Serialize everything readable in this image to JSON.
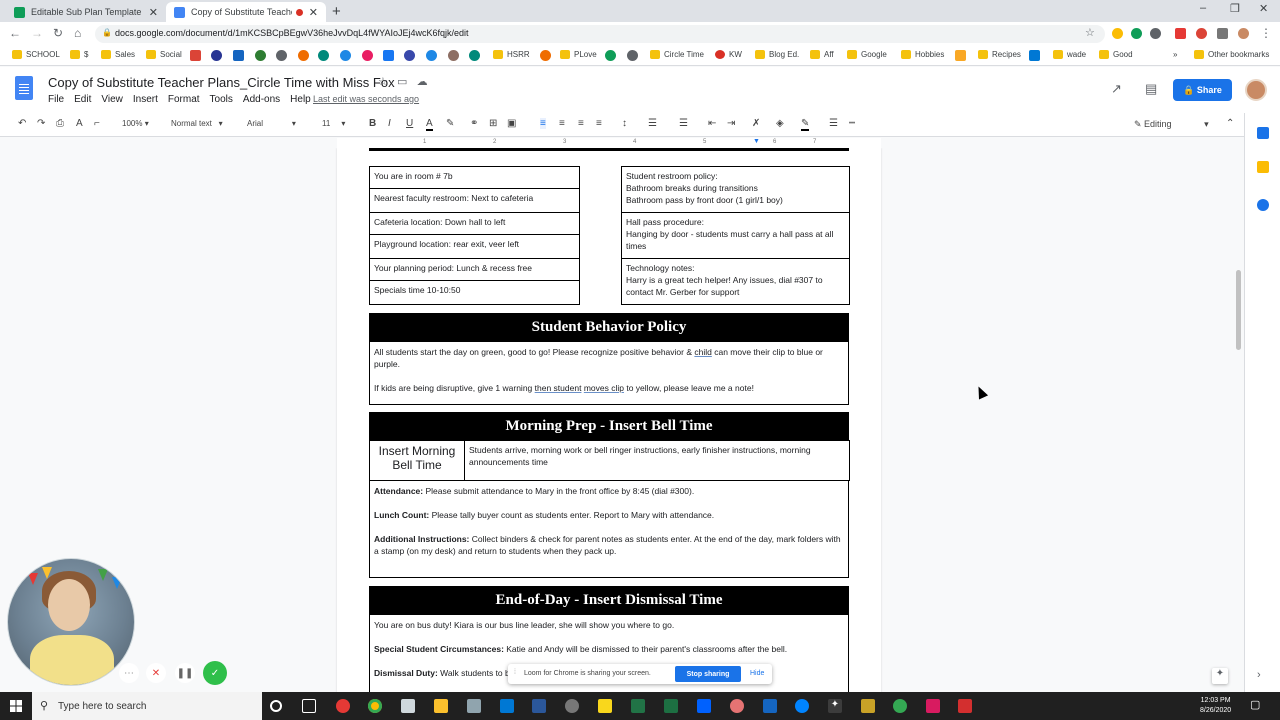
{
  "browser": {
    "tabs": [
      {
        "title": "Editable Sub Plan Template with",
        "favicon_color": "#0f9d58"
      },
      {
        "title": "Copy of Substitute Teacher P",
        "favicon_color": "#4285f4",
        "active": true
      }
    ],
    "new_tab_label": "+",
    "window_controls": {
      "minimize": "–",
      "restore": "❐",
      "close": "✕"
    },
    "url": "docs.google.com/document/d/1mKCSBCpBEgwV36heJvvDqL4fWYAIoJEj4wcK6fqjk/edit",
    "bookmarks": [
      "SCHOOL",
      "$",
      "Sales",
      "Social",
      "HSRR",
      "PLove",
      "Circle Time",
      "KW",
      "Blog Ed.",
      "Aff",
      "Google",
      "Hobbies",
      "Recipes",
      "wade",
      "Good",
      "»",
      "Other bookmarks"
    ]
  },
  "docs": {
    "title": "Copy of Substitute Teacher Plans_Circle Time with Miss Fox",
    "menu": [
      "File",
      "Edit",
      "View",
      "Insert",
      "Format",
      "Tools",
      "Add-ons",
      "Help"
    ],
    "last_edit": "Last edit was seconds ago",
    "share_label": "Share",
    "toolbar": {
      "zoom": "100%",
      "style": "Normal text",
      "font": "Arial",
      "size": "11",
      "mode": "Editing"
    },
    "ruler_marks": [
      "1",
      "2",
      "3",
      "4",
      "5",
      "6",
      "7"
    ]
  },
  "document": {
    "left_info": [
      "You are in room # 7b",
      "Nearest faculty restroom: Next to cafeteria",
      "Cafeteria location: Down hall to left",
      "Playground location: rear exit, veer left",
      "Your planning period: Lunch & recess free",
      "Specials time 10-10:50"
    ],
    "right_info": {
      "restroom_1": "Student restroom policy:",
      "restroom_2": "Bathroom breaks during transitions",
      "restroom_3": "Bathroom pass by front door (1 girl/1 boy)",
      "hallpass_1": "Hall pass procedure:",
      "hallpass_2": "Hanging by door - students must carry a hall pass at all times",
      "tech_1": "Technology notes:",
      "tech_2": "Harry is a great tech helper! Any issues, dial #307 to contact Mr. Gerber for support"
    },
    "behavior": {
      "heading": "Student Behavior Policy",
      "p1_a": "All students start the day on green, good to go! Please recognize positive behavior & ",
      "p1_b": "child",
      "p1_c": " can move their clip to blue or purple.",
      "p2_a": "If kids are being disruptive, give 1 warning ",
      "p2_b": "then student",
      "p2_c": " ",
      "p2_d": "moves clip",
      "p2_e": " to yellow, please leave me a note!"
    },
    "morning": {
      "heading": "Morning Prep - Insert Bell Time",
      "bell_label": "Insert Morning Bell Time",
      "bell_desc": "Students arrive, morning work or bell ringer instructions, early finisher instructions, morning announcements time",
      "attendance_label": "Attendance:",
      "attendance_text": " Please submit attendance to Mary in the front office by 8:45 (dial #300).",
      "lunch_label": "Lunch Count:",
      "lunch_text": " Please tally buyer count as students enter. Report to Mary with attendance.",
      "additional_label": "Additional Instructions:",
      "additional_text": " Collect binders & check for parent notes as students enter. At the end of the day, mark folders with a stamp (on my desk) and return to students when they pack up."
    },
    "endofday": {
      "heading": "End-of-Day - Insert Dismissal Time",
      "p1": "You are on bus duty! Kiara is our bus line leader, she will show you where to go.",
      "special_label": "Special Student Circumstances:",
      "special_text": " Katie and Andy will be dismissed to their parent's classrooms after the bell.",
      "dismissal_label": "Dismissal Duty:",
      "dismissal_text": " Walk students to bus ramp & follow line to last bus."
    }
  },
  "screen_share": {
    "message": "Loom for Chrome is sharing your screen.",
    "stop_label": "Stop sharing",
    "hide_label": "Hide"
  },
  "taskbar": {
    "search_placeholder": "Type here to search",
    "time": "12:03 PM",
    "date": "8/26/2020"
  },
  "colors": {
    "accent": "#1a73e8",
    "banner_bg": "#000000",
    "loom_green": "#2fbf4a",
    "loom_red": "#e53935"
  }
}
